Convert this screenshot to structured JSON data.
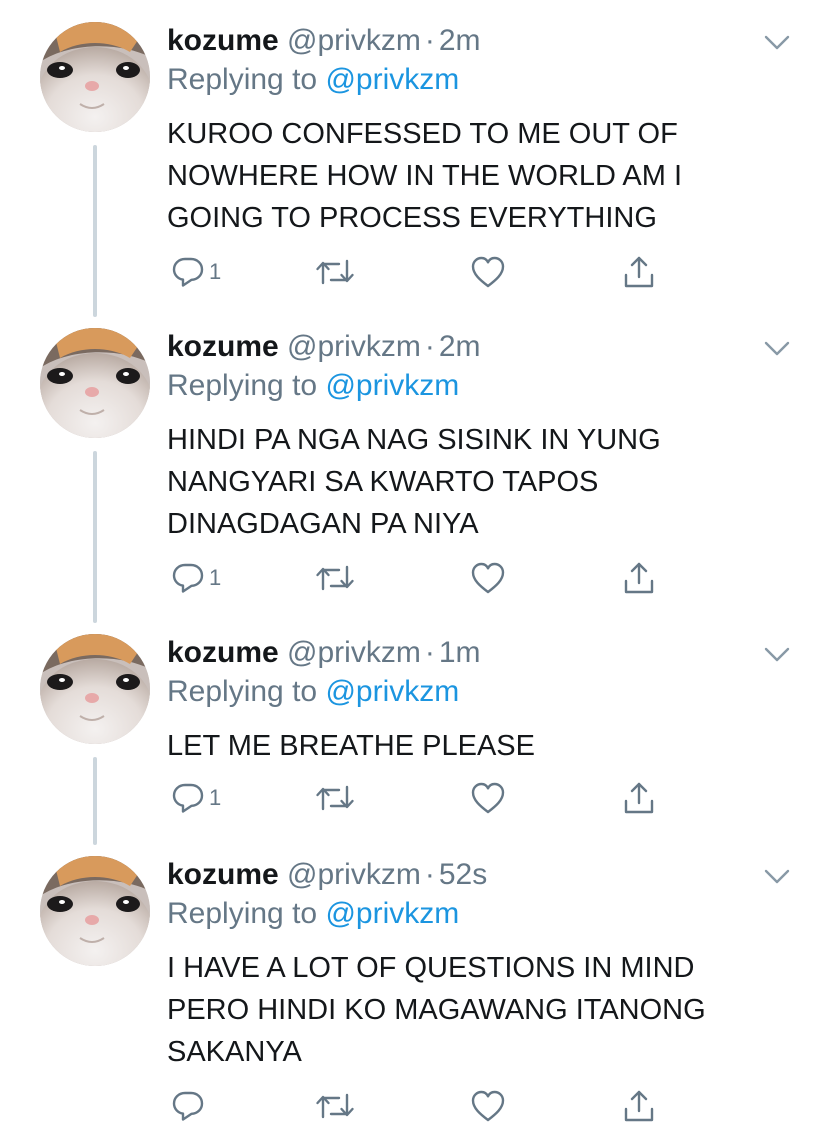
{
  "colors": {
    "text": "#14171a",
    "secondary": "#657786",
    "link": "#1b95e0",
    "thread_line": "#ccd6dd"
  },
  "tweets": [
    {
      "name": "kozume",
      "handle": "@privkzm",
      "separator": "·",
      "time": "2m",
      "replying_prefix": "Replying to",
      "replying_to": "@privkzm",
      "text": "KUROO CONFESSED TO ME OUT OF\nNOWHERE HOW IN THE WORLD AM I\nGOING TO PROCESS EVERYTHING",
      "reply_count": "1",
      "icons": [
        "avatar-cat-image",
        "chevron-down-icon",
        "reply-icon",
        "retweet-icon",
        "like-icon",
        "share-icon"
      ]
    },
    {
      "name": "kozume",
      "handle": "@privkzm",
      "separator": "·",
      "time": "2m",
      "replying_prefix": "Replying to",
      "replying_to": "@privkzm",
      "text": "HINDI PA NGA NAG SISINK IN YUNG\nNANGYARI SA KWARTO TAPOS\nDINAGDAGAN PA NIYA",
      "reply_count": "1",
      "icons": [
        "avatar-cat-image",
        "chevron-down-icon",
        "reply-icon",
        "retweet-icon",
        "like-icon",
        "share-icon"
      ]
    },
    {
      "name": "kozume",
      "handle": "@privkzm",
      "separator": "·",
      "time": "1m",
      "replying_prefix": "Replying to",
      "replying_to": "@privkzm",
      "text": "LET ME BREATHE PLEASE",
      "reply_count": "1",
      "icons": [
        "avatar-cat-image",
        "chevron-down-icon",
        "reply-icon",
        "retweet-icon",
        "like-icon",
        "share-icon"
      ]
    },
    {
      "name": "kozume",
      "handle": "@privkzm",
      "separator": "·",
      "time": "52s",
      "replying_prefix": "Replying to",
      "replying_to": "@privkzm",
      "text": "I HAVE A LOT OF QUESTIONS IN MIND\nPERO HINDI KO MAGAWANG ITANONG\nSAKANYA",
      "reply_count": "",
      "icons": [
        "avatar-cat-image",
        "chevron-down-icon",
        "reply-icon",
        "retweet-icon",
        "like-icon",
        "share-icon"
      ]
    }
  ]
}
